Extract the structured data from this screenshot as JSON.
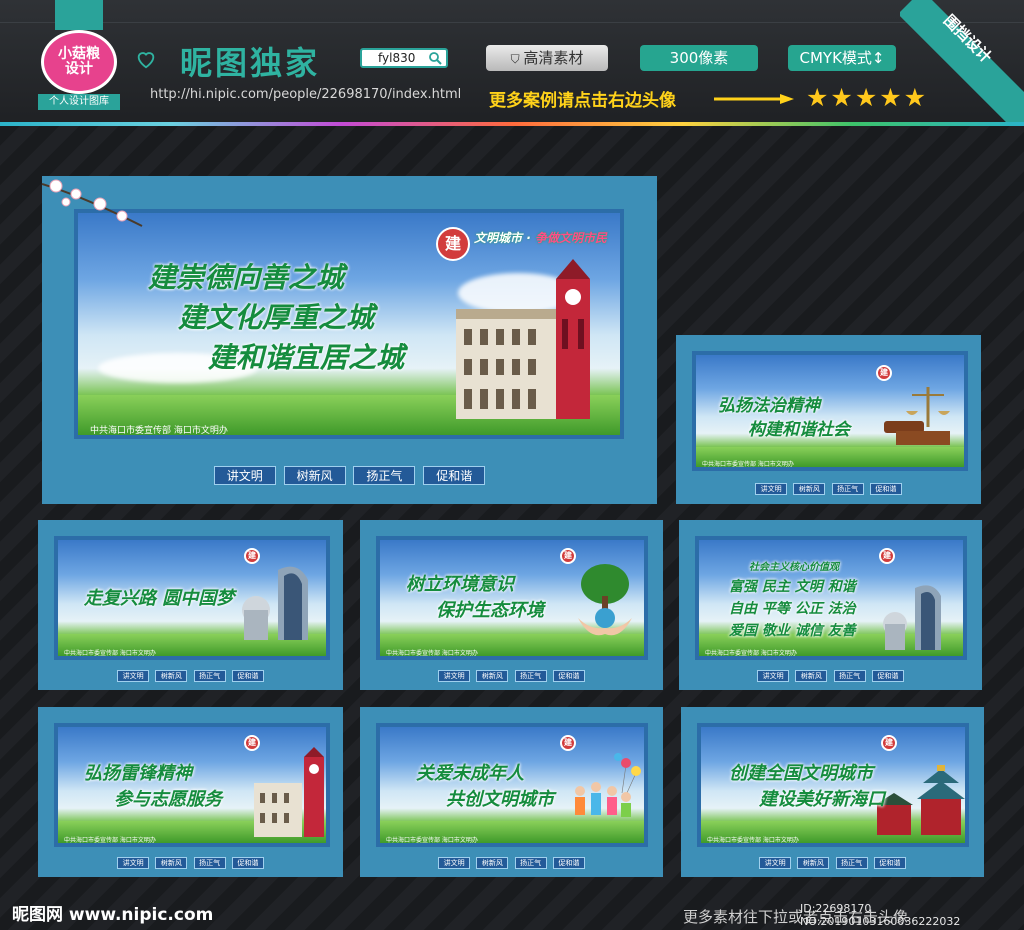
{
  "header": {
    "logo_badge_line1": "小菇粮",
    "logo_badge_line2": "设计",
    "logo_caption": "个人设计图库",
    "brand": "昵图独家",
    "search_value": "fyl830",
    "url": "http://hi.nipic.com/people/22698170/index.html",
    "pill_quality": "高清素材",
    "pill_dpi": "300像素",
    "pill_mode": "CMYK模式",
    "more_cases": "更多案例请点击右边头像",
    "stars": "★★★★★",
    "corner_label": "围挡设计"
  },
  "panels": [
    {
      "slogan_lines": [
        "建崇德向善之城",
        "建文化厚重之城",
        "建和谐宜居之城"
      ],
      "organizer": "中共海口市委宣传部  海口市文明办",
      "footer_words": [
        "讲文明",
        "树新风",
        "扬正气",
        "促和谐"
      ],
      "chuang": "建",
      "chuang_caption_a": "文明城市",
      "chuang_caption_b": "争做文明市民"
    },
    {
      "slogan_lines": [
        "弘扬法治精神",
        "构建和谐社会"
      ],
      "organizer": "中共海口市委宣传部  海口市文明办",
      "footer_words": [
        "讲文明",
        "树新风",
        "扬正气",
        "促和谐"
      ],
      "chuang": "建"
    },
    {
      "slogan_lines": [
        "走复兴路  圆中国梦"
      ],
      "organizer": "中共海口市委宣传部  海口市文明办",
      "footer_words": [
        "讲文明",
        "树新风",
        "扬正气",
        "促和谐"
      ],
      "chuang": "建"
    },
    {
      "slogan_lines": [
        "树立环境意识",
        "保护生态环境"
      ],
      "organizer": "中共海口市委宣传部  海口市文明办",
      "footer_words": [
        "讲文明",
        "树新风",
        "扬正气",
        "促和谐"
      ],
      "chuang": "建"
    },
    {
      "slogan_title": "社会主义核心价值观",
      "slogan_lines": [
        "富强  民主  文明  和谐",
        "自由  平等  公正  法治",
        "爱国  敬业  诚信  友善"
      ],
      "organizer": "中共海口市委宣传部  海口市文明办",
      "footer_words": [
        "讲文明",
        "树新风",
        "扬正气",
        "促和谐"
      ],
      "chuang": "建"
    },
    {
      "slogan_lines": [
        "弘扬雷锋精神",
        "参与志愿服务"
      ],
      "organizer": "中共海口市委宣传部  海口市文明办",
      "footer_words": [
        "讲文明",
        "树新风",
        "扬正气",
        "促和谐"
      ],
      "chuang": "建"
    },
    {
      "slogan_lines": [
        "关爱未成年人",
        "共创文明城市"
      ],
      "organizer": "中共海口市委宣传部  海口市文明办",
      "footer_words": [
        "讲文明",
        "树新风",
        "扬正气",
        "促和谐"
      ],
      "chuang": "建"
    },
    {
      "slogan_lines": [
        "创建全国文明城市",
        "建设美好新海口"
      ],
      "organizer": "中共海口市委宣传部  海口市文明办",
      "footer_words": [
        "讲文明",
        "树新风",
        "扬正气",
        "促和谐"
      ],
      "chuang": "建"
    }
  ],
  "footer": {
    "site": "昵图网 www.nipic.com",
    "more_materials": "更多素材往下拉或者点击右击头像",
    "image_id": "ID:22698170 NO:20190103160036222032"
  },
  "colors": {
    "accent": "#2aa39a",
    "slogan_green": "#158c3e",
    "frame_blue": "#3d8fb7",
    "star": "#ffc81c"
  }
}
